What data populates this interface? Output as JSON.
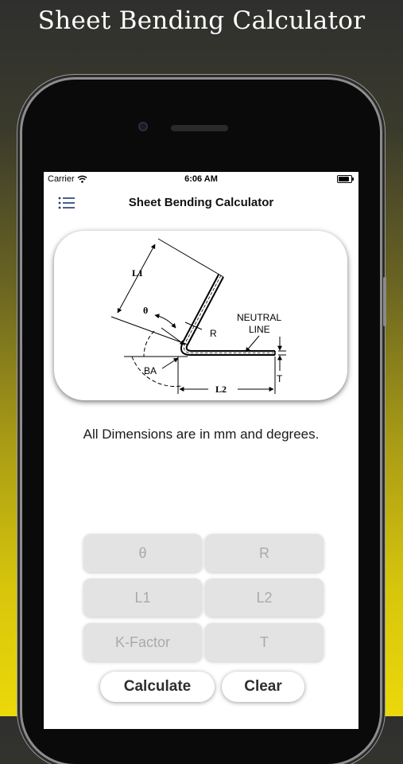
{
  "banner": {
    "title": "Sheet Bending Calculator"
  },
  "status_bar": {
    "carrier": "Carrier",
    "time": "6:06 AM"
  },
  "nav": {
    "title": "Sheet Bending Calculator"
  },
  "diagram": {
    "labels": {
      "l1": "L1",
      "theta": "θ",
      "r": "R",
      "neutral": "NEUTRAL",
      "line": "LINE",
      "ba": "BA",
      "l2": "L2",
      "t": "T"
    }
  },
  "note": "All Dimensions are in mm and degrees.",
  "inputs": {
    "theta": {
      "placeholder": "θ",
      "value": ""
    },
    "r": {
      "placeholder": "R",
      "value": ""
    },
    "l1": {
      "placeholder": "L1",
      "value": ""
    },
    "l2": {
      "placeholder": "L2",
      "value": ""
    },
    "kfactor": {
      "placeholder": "K-Factor",
      "value": ""
    },
    "t": {
      "placeholder": "T",
      "value": ""
    }
  },
  "buttons": {
    "calculate": "Calculate",
    "clear": "Clear"
  },
  "colors": {
    "background_top": "#2f2f2f",
    "background_bottom": "#ecd80a",
    "field_bg": "#e3e3e3"
  }
}
